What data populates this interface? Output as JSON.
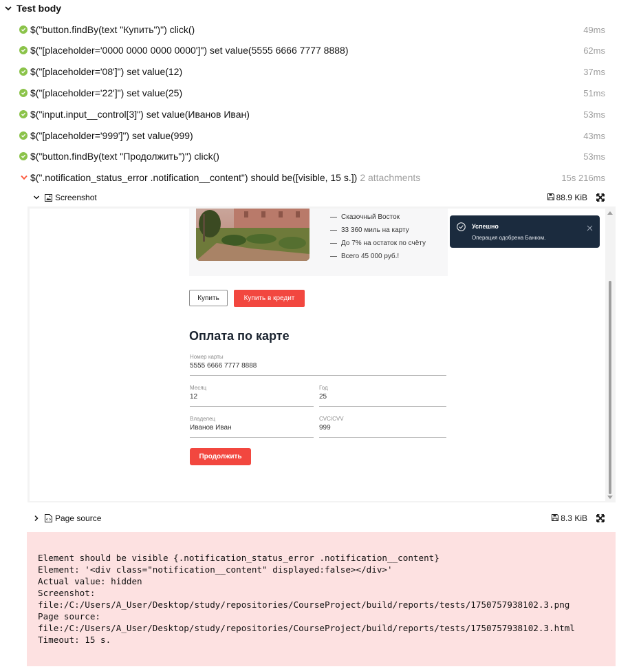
{
  "section": {
    "title": "Test body"
  },
  "steps": [
    {
      "text": "$(\"button.findBy(text \"Купить\")\") click()",
      "time": "49ms",
      "status": "passed"
    },
    {
      "text": "$(\"[placeholder='0000 0000 0000 0000']\") set value(5555 6666 7777 8888)",
      "time": "62ms",
      "status": "passed"
    },
    {
      "text": "$(\"[placeholder='08']\") set value(12)",
      "time": "37ms",
      "status": "passed"
    },
    {
      "text": "$(\"[placeholder='22']\") set value(25)",
      "time": "51ms",
      "status": "passed"
    },
    {
      "text": "$(\"input.input__control[3]\") set value(Иванов Иван)",
      "time": "53ms",
      "status": "passed"
    },
    {
      "text": "$(\"[placeholder='999']\") set value(999)",
      "time": "43ms",
      "status": "passed"
    },
    {
      "text": "$(\"button.findBy(text \"Продолжить\")\") click()",
      "time": "53ms",
      "status": "passed"
    },
    {
      "text": "$(\".notification_status_error .notification__content\") should be([visible, 15 s.])",
      "attachments": "2 attachments",
      "time": "15s 216ms",
      "status": "failed"
    }
  ],
  "attachments": {
    "screenshot": {
      "name": "Screenshot",
      "size": "88.9 KiB"
    },
    "page_source": {
      "name": "Page source",
      "size": "8.3 KiB"
    }
  },
  "screenshot_page": {
    "features": [
      "Сказочный Восток",
      "33 360 миль на карту",
      "До 7% на остаток по счёту",
      "Всего 45 000 руб.!"
    ],
    "buy_label": "Купить",
    "credit_label": "Купить в кредит",
    "payment_title": "Оплата по карте",
    "fields": {
      "card_number": {
        "label": "Номер карты",
        "value": "5555 6666 7777 8888"
      },
      "month": {
        "label": "Месяц",
        "value": "12"
      },
      "year": {
        "label": "Год",
        "value": "25"
      },
      "owner": {
        "label": "Владелец",
        "value": "Иванов Иван"
      },
      "cvc": {
        "label": "CVC/CVV",
        "value": "999"
      }
    },
    "continue_label": "Продолжить",
    "toast": {
      "title": "Успешно",
      "message": "Операция одобрена Банком."
    }
  },
  "error": {
    "text": "Element should be visible {.notification_status_error .notification__content}\nElement: '<div class=\"notification__content\" displayed:false></div>'\nActual value: hidden\nScreenshot:\nfile:/C:/Users/A_User/Desktop/study/repositories/CourseProject/build/reports/tests/1750757938102.3.png\nPage source:\nfile:/C:/Users/A_User/Desktop/study/repositories/CourseProject/build/reports/tests/1750757938102.3.html\nTimeout: 15 s."
  },
  "colors": {
    "passed": "#8bc34a",
    "failed": "#fd5a3e",
    "muted_text": "#9e9e9e",
    "error_bg": "#fde1e1",
    "toast_bg": "#1b2b3e",
    "accent_red": "#f2473f"
  },
  "icons": {
    "section_toggle": "chevron-down-icon",
    "step_passed": "check-circle-icon",
    "step_failed": "chevron-down-icon",
    "screenshot_type": "image-file-icon",
    "source_type": "code-file-icon",
    "size": "floppy-disk-icon",
    "expand": "fullscreen-icon"
  }
}
